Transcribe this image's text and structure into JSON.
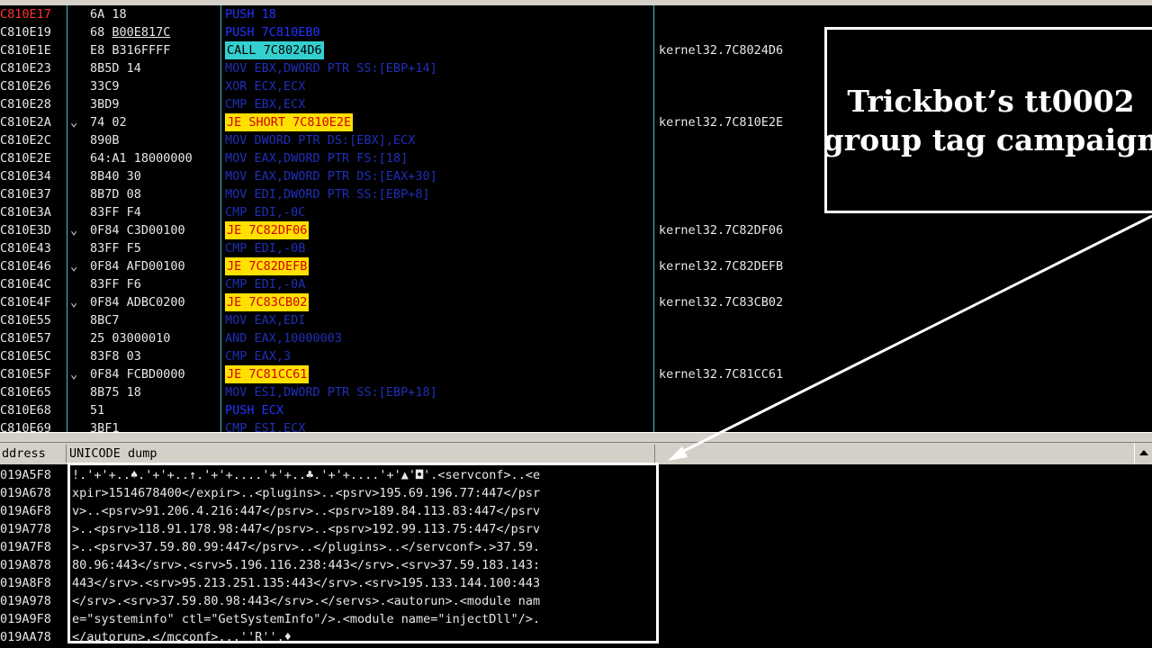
{
  "disassembly": {
    "rows": [
      {
        "addr": "C810E17",
        "bytes": "6A 18",
        "instr": "PUSH 18",
        "comment": ""
      },
      {
        "addr": "C810E19",
        "bytes": "68 B00E817C",
        "instr": "PUSH 7C810EB0",
        "comment": ""
      },
      {
        "addr": "C810E1E",
        "bytes": "E8 B316FFFF",
        "instr": "CALL 7C8024D6",
        "comment": "kernel32.7C8024D6"
      },
      {
        "addr": "C810E23",
        "bytes": "8B5D 14",
        "instr": "MOV EBX,DWORD PTR SS:[EBP+14]",
        "comment": ""
      },
      {
        "addr": "C810E26",
        "bytes": "33C9",
        "instr": "XOR ECX,ECX",
        "comment": ""
      },
      {
        "addr": "C810E28",
        "bytes": "3BD9",
        "instr": "CMP EBX,ECX",
        "comment": ""
      },
      {
        "addr": "C810E2A",
        "bytes": "74 02",
        "instr": "JE SHORT 7C810E2E",
        "comment": "kernel32.7C810E2E"
      },
      {
        "addr": "C810E2C",
        "bytes": "890B",
        "instr": "MOV DWORD PTR DS:[EBX],ECX",
        "comment": ""
      },
      {
        "addr": "C810E2E",
        "bytes": "64:A1 18000000",
        "instr": "MOV EAX,DWORD PTR FS:[18]",
        "comment": ""
      },
      {
        "addr": "C810E34",
        "bytes": "8B40 30",
        "instr": "MOV EAX,DWORD PTR DS:[EAX+30]",
        "comment": ""
      },
      {
        "addr": "C810E37",
        "bytes": "8B7D 08",
        "instr": "MOV EDI,DWORD PTR SS:[EBP+8]",
        "comment": ""
      },
      {
        "addr": "C810E3A",
        "bytes": "83FF F4",
        "instr": "CMP EDI,-0C",
        "comment": ""
      },
      {
        "addr": "C810E3D",
        "bytes": "0F84 C3D00100",
        "instr": "JE 7C82DF06",
        "comment": "kernel32.7C82DF06"
      },
      {
        "addr": "C810E43",
        "bytes": "83FF F5",
        "instr": "CMP EDI,-0B",
        "comment": ""
      },
      {
        "addr": "C810E46",
        "bytes": "0F84 AFD00100",
        "instr": "JE 7C82DEFB",
        "comment": "kernel32.7C82DEFB"
      },
      {
        "addr": "C810E4C",
        "bytes": "83FF F6",
        "instr": "CMP EDI,-0A",
        "comment": ""
      },
      {
        "addr": "C810E4F",
        "bytes": "0F84 ADBC0200",
        "instr": "JE 7C83CB02",
        "comment": "kernel32.7C83CB02"
      },
      {
        "addr": "C810E55",
        "bytes": "8BC7",
        "instr": "MOV EAX,EDI",
        "comment": ""
      },
      {
        "addr": "C810E57",
        "bytes": "25 03000010",
        "instr": "AND EAX,10000003",
        "comment": ""
      },
      {
        "addr": "C810E5C",
        "bytes": "83F8 03",
        "instr": "CMP EAX,3",
        "comment": ""
      },
      {
        "addr": "C810E5F",
        "bytes": "0F84 FCBD0000",
        "instr": "JE 7C81CC61",
        "comment": "kernel32.7C81CC61"
      },
      {
        "addr": "C810E65",
        "bytes": "8B75 18",
        "instr": "MOV ESI,DWORD PTR SS:[EBP+18]",
        "comment": ""
      },
      {
        "addr": "C810E68",
        "bytes": "51",
        "instr": "PUSH ECX",
        "comment": ""
      },
      {
        "addr": "C810E69",
        "bytes": "3BF1",
        "instr": "CMP ESI,ECX",
        "comment": ""
      }
    ]
  },
  "callout": {
    "text": "Trickbot’s tt0002\ngroup tag campaign"
  },
  "dump": {
    "header": {
      "address_col": "ddress",
      "dump_col": "UNICODE dump"
    },
    "rows": [
      {
        "addr": "019A5F8",
        "text": "!.'+'+..♠.'+'+..↑.'+'+....'+'+..♣.'+'+....'+'▲'◘'.<servconf>..<e"
      },
      {
        "addr": "019A678",
        "text": "xpir>1514678400</expir>..<plugins>..<psrv>195.69.196.77:447</psr"
      },
      {
        "addr": "019A6F8",
        "text": "v>..<psrv>91.206.4.216:447</psrv>..<psrv>189.84.113.83:447</psrv"
      },
      {
        "addr": "019A778",
        "text": ">..<psrv>118.91.178.98:447</psrv>..<psrv>192.99.113.75:447</psrv"
      },
      {
        "addr": "019A7F8",
        "text": ">..<psrv>37.59.80.99:447</psrv>..</plugins>..</servconf>.>37.59."
      },
      {
        "addr": "019A878",
        "text": "80.96:443</srv>.<srv>5.196.116.238:443</srv>.<srv>37.59.183.143:"
      },
      {
        "addr": "019A8F8",
        "text": "443</srv>.<srv>95.213.251.135:443</srv>.<srv>195.133.144.100:443"
      },
      {
        "addr": "019A978",
        "text": "</srv>.<srv>37.59.80.98:443</srv>.</servs>.<autorun>.<module nam"
      },
      {
        "addr": "019A9F8",
        "text": "e=\"systeminfo\" ctl=\"GetSystemInfo\"/>.<module name=\"injectDll\"/>."
      },
      {
        "addr": "019AA78",
        "text": "</autorun>.</mcconf>...''R''.♦"
      }
    ]
  },
  "colors": {
    "background": "#000000",
    "address_highlight": "#ff3030",
    "instruction_text": "#1f2fb8",
    "jump_highlight_bg": "#ffe100",
    "jump_highlight_fg": "#d40000",
    "call_highlight_bg": "#34d0d0",
    "column_divider": "#3fc5c5"
  }
}
